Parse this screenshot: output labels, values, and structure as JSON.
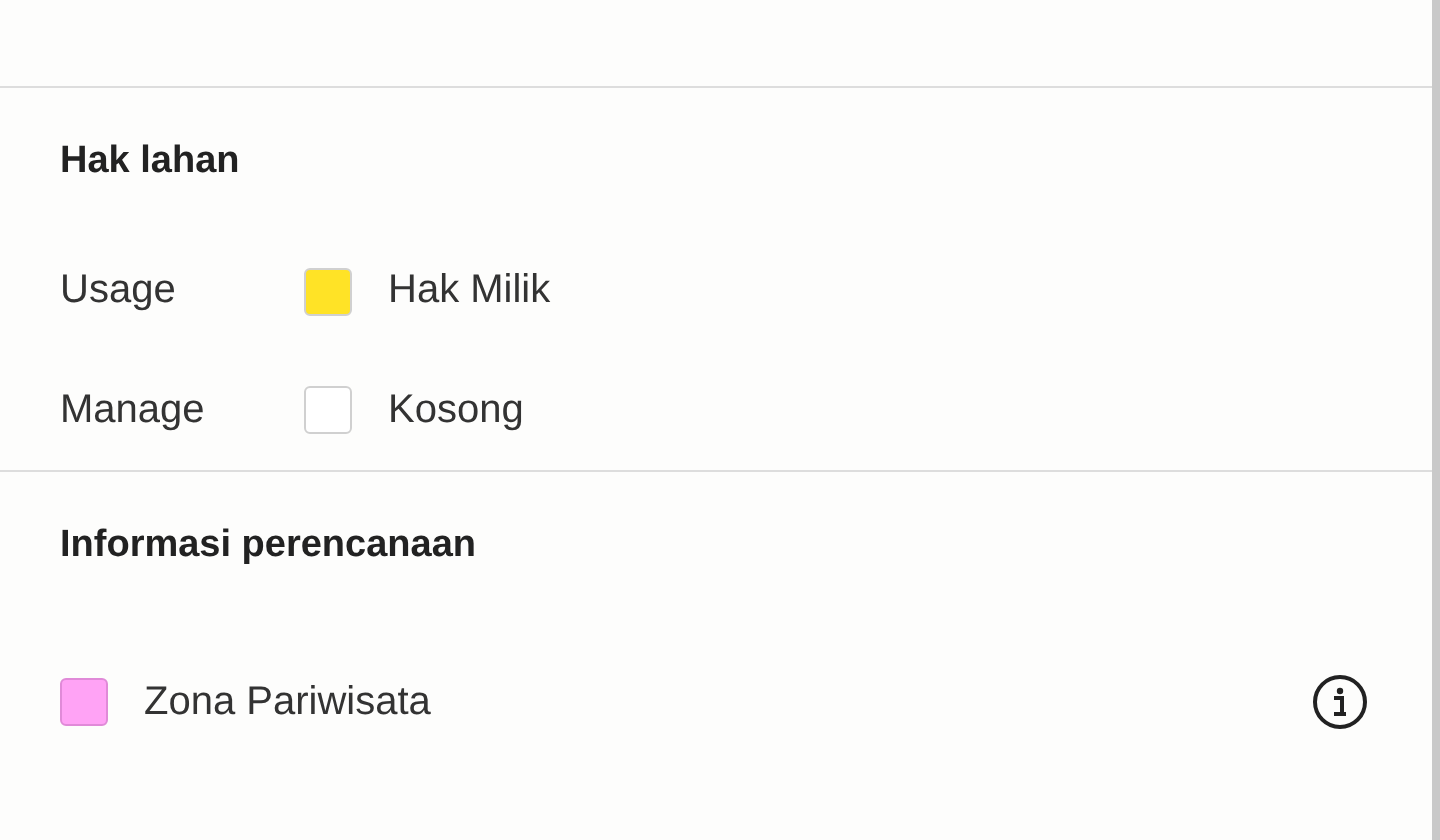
{
  "land_rights": {
    "title": "Hak lahan",
    "rows": [
      {
        "label": "Usage",
        "value": "Hak Milik",
        "color": "#ffe326"
      },
      {
        "label": "Manage",
        "value": "Kosong",
        "color": "#ffffff"
      }
    ]
  },
  "planning": {
    "title": "Informasi perencanaan",
    "zones": [
      {
        "name": "Zona Pariwisata",
        "color": "#ffa3f5"
      }
    ]
  }
}
